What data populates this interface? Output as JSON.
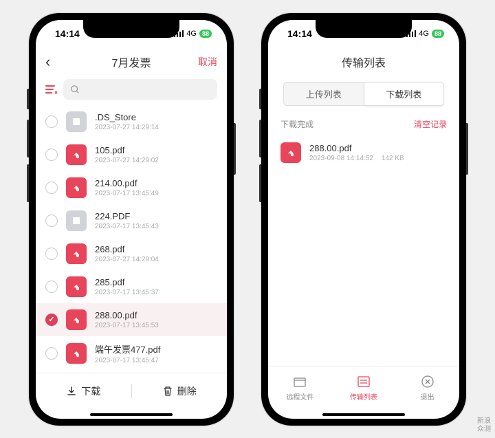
{
  "status": {
    "time": "14:14",
    "network": "4G",
    "battery": "88"
  },
  "phone1": {
    "title": "7月发票",
    "cancel": "取消",
    "files": [
      {
        "name": ".DS_Store",
        "date": "2023-07-27 14:29:14",
        "type": "other",
        "selected": false
      },
      {
        "name": "105.pdf",
        "date": "2023-07-27 14:29:02",
        "type": "pdf",
        "selected": false
      },
      {
        "name": "214.00.pdf",
        "date": "2023-07-17 13:45:49",
        "type": "pdf",
        "selected": false
      },
      {
        "name": "224.PDF",
        "date": "2023-07-17 13:45:43",
        "type": "other",
        "selected": false
      },
      {
        "name": "268.pdf",
        "date": "2023-07-27 14:29:04",
        "type": "pdf",
        "selected": false
      },
      {
        "name": "285.pdf",
        "date": "2023-07-17 13:45:37",
        "type": "pdf",
        "selected": false
      },
      {
        "name": "288.00.pdf",
        "date": "2023-07-17 13:45:53",
        "type": "pdf",
        "selected": true
      },
      {
        "name": "端午发票477.pdf",
        "date": "2023-07-17 13:45:47",
        "type": "pdf",
        "selected": false
      }
    ],
    "download": "下载",
    "delete": "删除"
  },
  "phone2": {
    "title": "传输列表",
    "tabs": {
      "upload": "上传列表",
      "download": "下载列表"
    },
    "section": {
      "title": "下载完成",
      "clear": "清空记录"
    },
    "items": [
      {
        "name": "288.00.pdf",
        "date": "2023-09-08 14:14:52",
        "size": "142 KB"
      }
    ],
    "nav": {
      "remote": "远程文件",
      "transfer": "传输列表",
      "exit": "退出"
    }
  },
  "watermark": {
    "line1": "新浪",
    "line2": "众测"
  }
}
